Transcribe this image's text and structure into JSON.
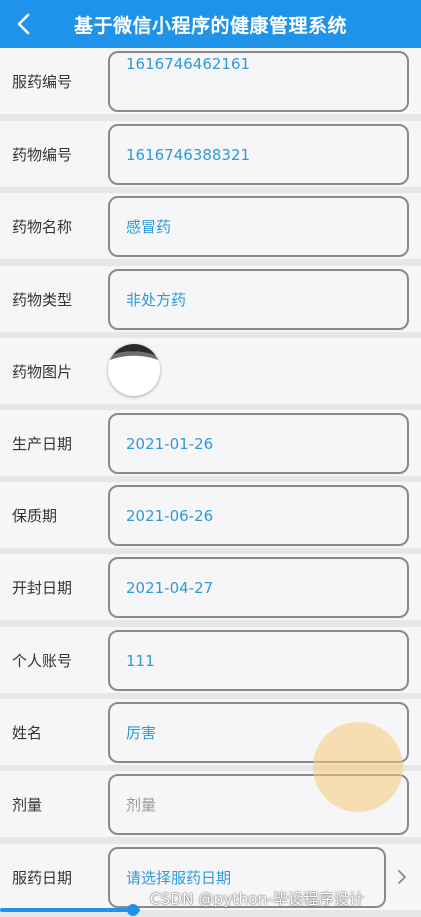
{
  "header": {
    "title": "基于微信小程序的健康管理系统"
  },
  "fields": {
    "medication_id": {
      "label": "服药编号",
      "value": "1616746462161"
    },
    "drug_id": {
      "label": "药物编号",
      "value": "1616746388321"
    },
    "drug_name": {
      "label": "药物名称",
      "value": "感冒药"
    },
    "drug_type": {
      "label": "药物类型",
      "value": "非处方药"
    },
    "drug_image": {
      "label": "药物图片"
    },
    "production_date": {
      "label": "生产日期",
      "value": "2021-01-26"
    },
    "expiry_date": {
      "label": "保质期",
      "value": "2021-06-26"
    },
    "opened_date": {
      "label": "开封日期",
      "value": "2021-04-27"
    },
    "account": {
      "label": "个人账号",
      "value": "111"
    },
    "name": {
      "label": "姓名",
      "value": "厉害"
    },
    "dosage": {
      "label": "剂量",
      "placeholder": "剂量"
    },
    "medication_date": {
      "label": "服药日期",
      "placeholder": "请选择服药日期"
    }
  },
  "watermark": "CSDN @python-毕设程序设计",
  "colors": {
    "header": "#1f93ea",
    "value_text": "#2e9ad8",
    "placeholder_text": "#9a9a9a",
    "touch_indicator": "#f7c978"
  },
  "icons": {
    "back": "back-arrow-icon",
    "select": "chevron-right-icon"
  }
}
